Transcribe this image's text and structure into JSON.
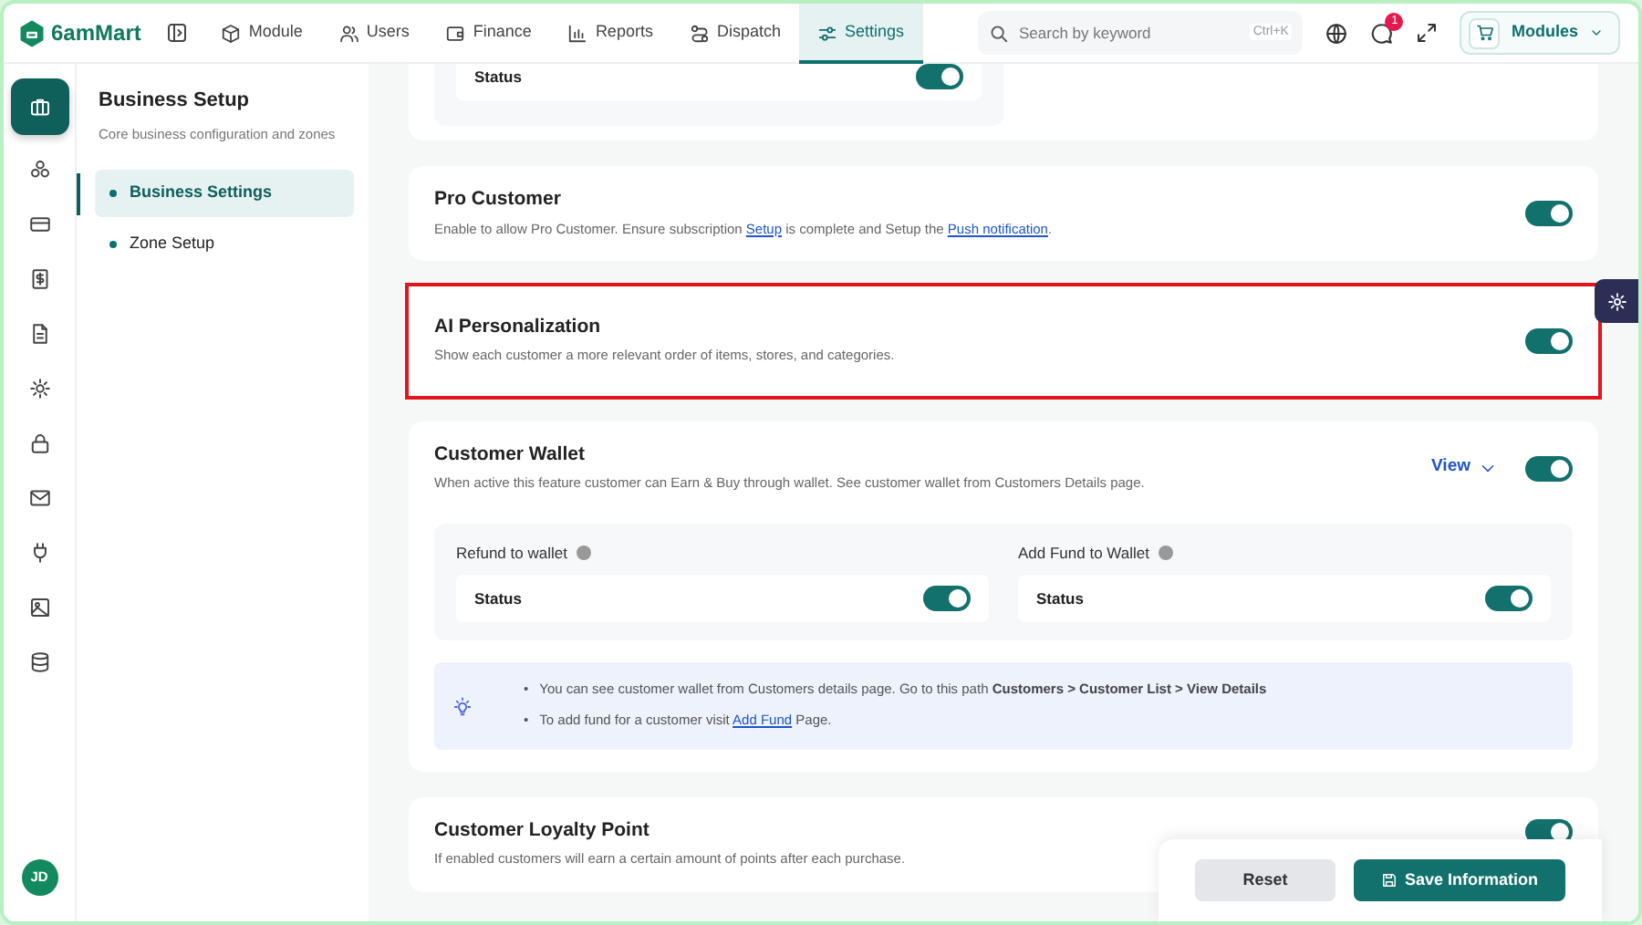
{
  "brand": "6amMart",
  "nav_tabs": [
    {
      "label": "Module",
      "selected": false
    },
    {
      "label": "Users",
      "selected": false
    },
    {
      "label": "Finance",
      "selected": false
    },
    {
      "label": "Reports",
      "selected": false
    },
    {
      "label": "Dispatch",
      "selected": false
    },
    {
      "label": "Settings",
      "selected": true
    }
  ],
  "search": {
    "placeholder": "Search by keyword",
    "shortcut": "Ctrl+K"
  },
  "notification_count": "1",
  "modules_button": "Modules",
  "rail": {
    "items": [
      {
        "selected": true
      },
      {
        "selected": false
      },
      {
        "selected": false
      },
      {
        "selected": false
      },
      {
        "selected": false
      },
      {
        "selected": false
      },
      {
        "selected": false
      },
      {
        "selected": false
      },
      {
        "selected": false
      },
      {
        "selected": false
      },
      {
        "selected": false
      }
    ],
    "avatar": "JD"
  },
  "sidebar": {
    "title": "Business Setup",
    "subtitle": "Core business configuration and zones",
    "items": [
      {
        "label": "Business Settings",
        "selected": true
      },
      {
        "label": "Zone Setup",
        "selected": false
      }
    ]
  },
  "sections": [
    {
      "kind": "partial",
      "status_label": "Status",
      "on": true
    },
    {
      "kind": "setting",
      "title": "Pro Customer",
      "highlighted": false,
      "on": true,
      "description": [
        {
          "kind": "text",
          "text": "Enable to allow Pro Customer. Ensure subscription "
        },
        {
          "kind": "link",
          "text": "Setup"
        },
        {
          "kind": "text",
          "text": " is complete and Setup the "
        },
        {
          "kind": "link",
          "text": "Push notification"
        },
        {
          "kind": "text",
          "text": "."
        }
      ]
    },
    {
      "kind": "setting",
      "title": "AI Personalization",
      "highlighted": true,
      "on": true,
      "description": [
        {
          "kind": "text",
          "text": "Show each customer a more relevant order of items, stores, and categories."
        }
      ]
    },
    {
      "kind": "wallet",
      "title": "Customer Wallet",
      "view_label": "View",
      "on": true,
      "description": [
        {
          "kind": "text",
          "text": "When active this feature customer can Earn & Buy through wallet. See customer wallet from Customers Details page."
        }
      ],
      "options": [
        {
          "label": "Refund to wallet",
          "status_label": "Status",
          "on": true
        },
        {
          "label": "Add Fund to Wallet",
          "status_label": "Status",
          "on": true
        }
      ],
      "notes": [
        {
          "marker": "•",
          "parts": [
            {
              "kind": "text",
              "text": "You can see customer wallet from Customers details page. Go to this path **Customers > Customer List > View Details**"
            }
          ]
        },
        {
          "marker": "•",
          "parts": [
            {
              "kind": "text",
              "text": "To add fund for a customer visit "
            },
            {
              "kind": "link",
              "text": "Add Fund"
            },
            {
              "kind": "text",
              "text": " Page."
            }
          ]
        }
      ]
    },
    {
      "kind": "setting",
      "title": "Customer Loyalty Point",
      "highlighted": false,
      "top_toggle": true,
      "on": true,
      "description": [
        {
          "kind": "text",
          "text": "If enabled customers will earn a certain amount of points after each purchase."
        }
      ]
    }
  ],
  "actions": {
    "reset": "Reset",
    "save": "Save Information"
  }
}
